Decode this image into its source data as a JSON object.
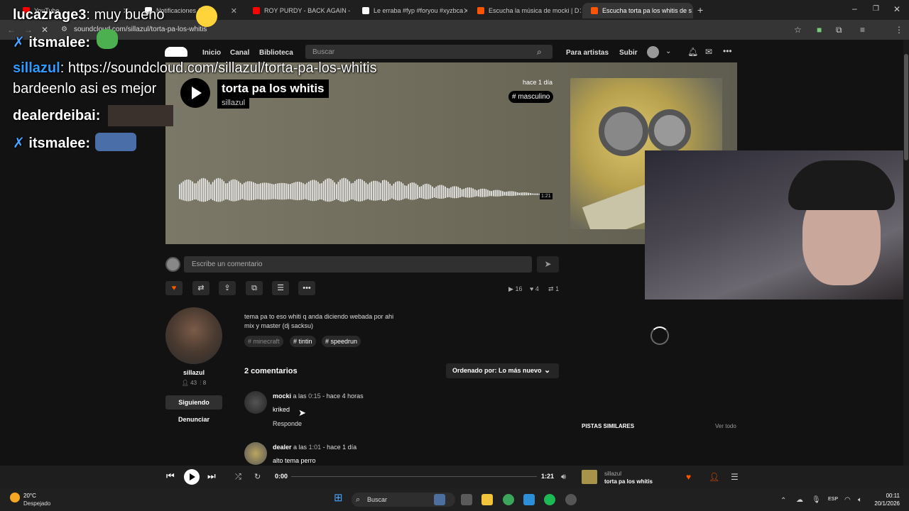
{
  "browser": {
    "tabs": [
      {
        "title": "YouTube",
        "favicon_color": "#ff0000"
      },
      {
        "title": "Notificaciones / X",
        "favicon_color": "#ffffff"
      },
      {
        "title": "ROY PURDY - BACK AGAIN - Yo",
        "favicon_color": "#ff0000"
      },
      {
        "title": "Le erraba #fyp #foryou #xyzbca",
        "favicon_color": "#ffffff"
      },
      {
        "title": "Escucha la música de mocki | D",
        "favicon_color": "#ff5500"
      },
      {
        "title": "Escucha torta pa los whitis de s",
        "favicon_color": "#ff5500"
      }
    ],
    "url": "soundcloud.com/sillazul/torta-pa-los-whitis"
  },
  "header": {
    "nav": [
      "Inicio",
      "Canal",
      "Biblioteca"
    ],
    "search_placeholder": "Buscar",
    "for_artists": "Para artistas",
    "upload": "Subir"
  },
  "chat": [
    {
      "user": "lucazrage3",
      "text": ": muy bueno",
      "color": "#ffffff"
    },
    {
      "user": "itsmalee:",
      "text": "",
      "color": "#ffffff"
    },
    {
      "user": "sillazul",
      "text": ": https://soundcloud.com/sillazul/torta-pa-los-whitis",
      "color": "#2f9bff"
    },
    {
      "user": "",
      "text": "bardeenlo asi es mejor",
      "color": "#ffffff"
    },
    {
      "user": "dealerdeibai:",
      "text": "",
      "color": "#ffffff"
    },
    {
      "user": "itsmalee:",
      "text": "",
      "color": "#ffffff"
    }
  ],
  "track": {
    "title": "torta pa los whitis",
    "user": "sillazul",
    "age": "hace 1 día",
    "genre_tag": "# masculino",
    "duration": "1:21"
  },
  "comment_box": {
    "placeholder": "Escribe un comentario"
  },
  "stats": {
    "plays": "16",
    "likes": "4",
    "reposts": "1"
  },
  "uploader": {
    "name": "sillazul",
    "followers": "43",
    "tracks": "8",
    "following_label": "Siguiendo",
    "report_label": "Denunciar"
  },
  "description": {
    "line1": "tema pa to eso whiti q anda diciendo webada por ahi",
    "line2": "mix y master (dj sacksu)",
    "tags": [
      "# minecraft",
      "# tintin",
      "# speedrun"
    ]
  },
  "comments": {
    "count_label": "2 comentarios",
    "sort_label": "Ordenado por: Lo más nuevo",
    "items": [
      {
        "user": "mocki",
        "at": "a las",
        "time": "0:15",
        "age": "- hace 4 horas",
        "text": "kriked",
        "reply": "Responde"
      },
      {
        "user": "dealer",
        "at": "a las",
        "time": "1:01",
        "age": "- hace 1 día",
        "text": "alto tema perro"
      }
    ]
  },
  "sidebar": {
    "similar": "PISTAS SIMILARES",
    "see_all": "Ver todo"
  },
  "player": {
    "current": "0:00",
    "duration": "1:21",
    "progress": 0,
    "user": "sillazul",
    "title": "torta pa los whitis"
  },
  "taskbar": {
    "temp": "20°C",
    "weather": "Despejado",
    "search_placeholder": "Buscar",
    "lang": "ESP",
    "time": "00:11",
    "date": "20/1/2026"
  }
}
